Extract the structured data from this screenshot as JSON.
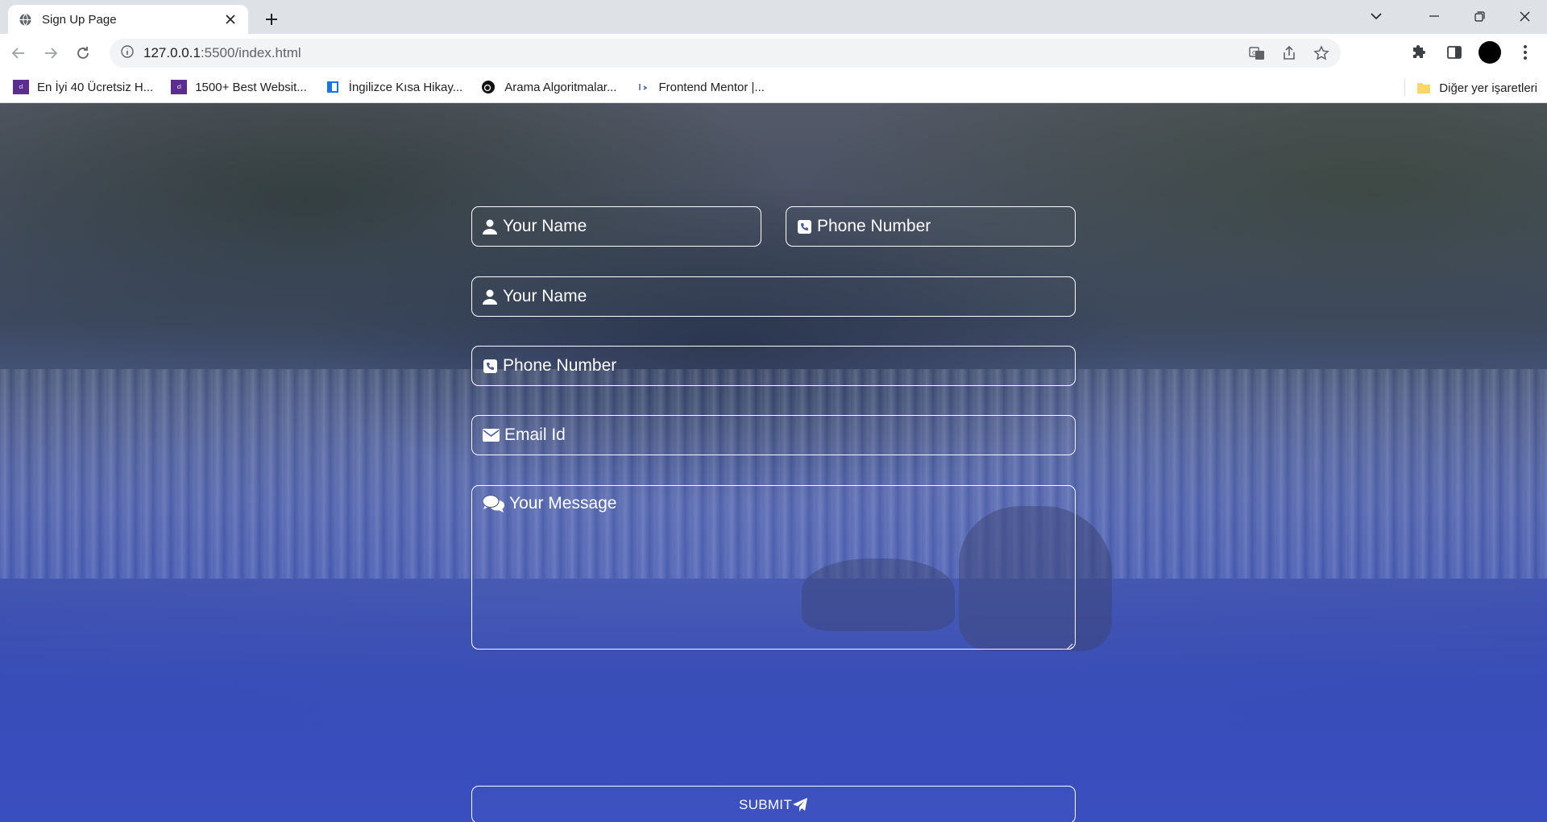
{
  "browser": {
    "tab_title": "Sign Up Page",
    "url_host": "127.0.0.1",
    "url_rest": ":5500/index.html",
    "bookmarks": [
      {
        "label": "En İyi 40 Ücretsiz H...",
        "icon": "colorlib-icon",
        "color": "#5b2d8e"
      },
      {
        "label": "1500+ Best Websit...",
        "icon": "colorlib-icon",
        "color": "#5b2d8e"
      },
      {
        "label": "İngilizce Kısa Hikay...",
        "icon": "window-icon",
        "color": "#1a73e8"
      },
      {
        "label": "Arama Algoritmalar...",
        "icon": "circle-logo-icon",
        "color": "#111111"
      },
      {
        "label": "Frontend Mentor |...",
        "icon": "frontend-mentor-icon",
        "color": "#3e54a3"
      }
    ],
    "bookmarks_other": "Diğer yer işaretleri"
  },
  "form": {
    "name_short": "Your Name",
    "phone_short": "Phone Number",
    "name_full": "Your Name",
    "phone_full": "Phone Number",
    "email": "Email Id",
    "message": "Your Message",
    "submit": "SUBMIT"
  },
  "colors": {
    "accent": "#3a4fbf",
    "field_border": "#ffffff"
  }
}
